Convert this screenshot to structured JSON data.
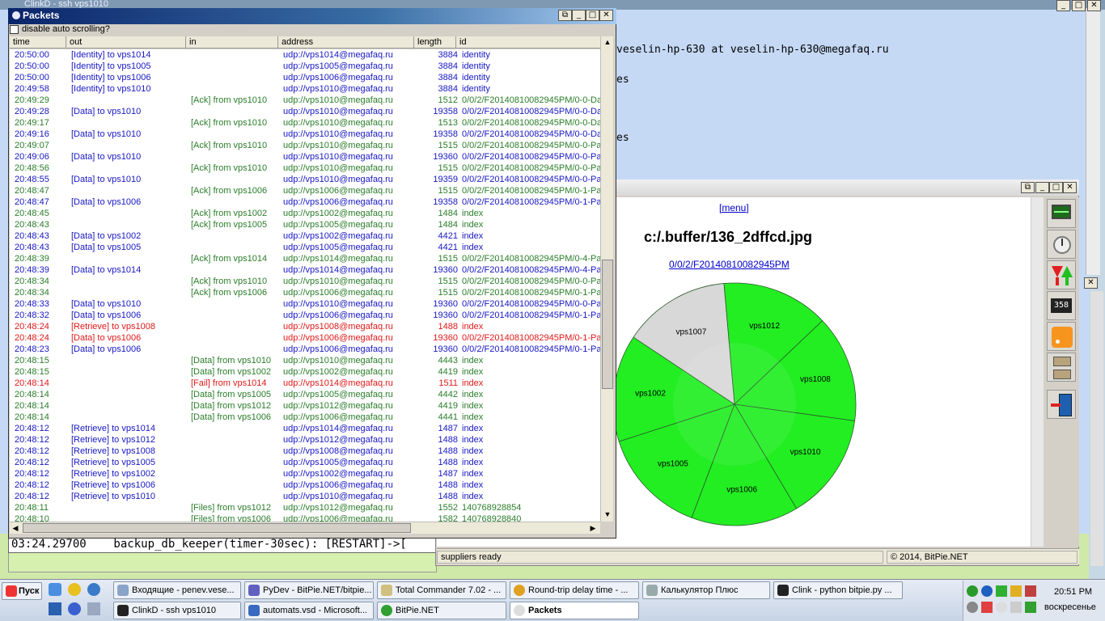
{
  "ssh_window": {
    "title": "ClinkD - ssh vps1010",
    "terminal_lines": [
      "veselin-hp-630 at veselin-hp-630@megafaq.ru",
      "es",
      "es"
    ],
    "bottom_line": "03:24.29700    backup_db_keeper(timer-30sec): [RESTART]->["
  },
  "packets_window": {
    "title": "Packets",
    "disable_autoscroll_label": "disable auto scrolling?",
    "columns": [
      "time",
      "out",
      "in",
      "address",
      "length",
      "id"
    ],
    "rows": [
      {
        "time": "20:50:00",
        "out": "[Identity] to vps1014",
        "in": "",
        "address": "udp://vps1014@megafaq.ru",
        "length": "3884",
        "id": "identity",
        "color": "blue"
      },
      {
        "time": "20:50:00",
        "out": "[Identity] to vps1005",
        "in": "",
        "address": "udp://vps1005@megafaq.ru",
        "length": "3884",
        "id": "identity",
        "color": "blue"
      },
      {
        "time": "20:50:00",
        "out": "[Identity] to vps1006",
        "in": "",
        "address": "udp://vps1006@megafaq.ru",
        "length": "3884",
        "id": "identity",
        "color": "blue"
      },
      {
        "time": "20:49:58",
        "out": "[Identity] to vps1010",
        "in": "",
        "address": "udp://vps1010@megafaq.ru",
        "length": "3884",
        "id": "identity",
        "color": "blue"
      },
      {
        "time": "20:49:29",
        "out": "",
        "in": "[Ack] from vps1010",
        "address": "udp://vps1010@megafaq.ru",
        "length": "1512",
        "id": "0/0/2/F20140810082945PM/0-0-Da",
        "color": "green"
      },
      {
        "time": "20:49:28",
        "out": "[Data] to vps1010",
        "in": "",
        "address": "udp://vps1010@megafaq.ru",
        "length": "19358",
        "id": "0/0/2/F20140810082945PM/0-0-Da",
        "color": "blue"
      },
      {
        "time": "20:49:17",
        "out": "",
        "in": "[Ack] from vps1010",
        "address": "udp://vps1010@megafaq.ru",
        "length": "1513",
        "id": "0/0/2/F20140810082945PM/0-0-Da",
        "color": "green"
      },
      {
        "time": "20:49:16",
        "out": "[Data] to vps1010",
        "in": "",
        "address": "udp://vps1010@megafaq.ru",
        "length": "19358",
        "id": "0/0/2/F20140810082945PM/0-0-Da",
        "color": "blue"
      },
      {
        "time": "20:49:07",
        "out": "",
        "in": "[Ack] from vps1010",
        "address": "udp://vps1010@megafaq.ru",
        "length": "1515",
        "id": "0/0/2/F20140810082945PM/0-0-Pa",
        "color": "green"
      },
      {
        "time": "20:49:06",
        "out": "[Data] to vps1010",
        "in": "",
        "address": "udp://vps1010@megafaq.ru",
        "length": "19360",
        "id": "0/0/2/F20140810082945PM/0-0-Pa",
        "color": "blue"
      },
      {
        "time": "20:48:56",
        "out": "",
        "in": "[Ack] from vps1010",
        "address": "udp://vps1010@megafaq.ru",
        "length": "1515",
        "id": "0/0/2/F20140810082945PM/0-0-Pa",
        "color": "green"
      },
      {
        "time": "20:48:55",
        "out": "[Data] to vps1010",
        "in": "",
        "address": "udp://vps1010@megafaq.ru",
        "length": "19359",
        "id": "0/0/2/F20140810082945PM/0-0-Pa",
        "color": "blue"
      },
      {
        "time": "20:48:47",
        "out": "",
        "in": "[Ack] from vps1006",
        "address": "udp://vps1006@megafaq.ru",
        "length": "1515",
        "id": "0/0/2/F20140810082945PM/0-1-Pa",
        "color": "green"
      },
      {
        "time": "20:48:47",
        "out": "[Data] to vps1006",
        "in": "",
        "address": "udp://vps1006@megafaq.ru",
        "length": "19358",
        "id": "0/0/2/F20140810082945PM/0-1-Pa",
        "color": "blue"
      },
      {
        "time": "20:48:45",
        "out": "",
        "in": "[Ack] from vps1002",
        "address": "udp://vps1002@megafaq.ru",
        "length": "1484",
        "id": "index",
        "color": "green"
      },
      {
        "time": "20:48:43",
        "out": "",
        "in": "[Ack] from vps1005",
        "address": "udp://vps1005@megafaq.ru",
        "length": "1484",
        "id": "index",
        "color": "green"
      },
      {
        "time": "20:48:43",
        "out": "[Data] to vps1002",
        "in": "",
        "address": "udp://vps1002@megafaq.ru",
        "length": "4421",
        "id": "index",
        "color": "blue"
      },
      {
        "time": "20:48:43",
        "out": "[Data] to vps1005",
        "in": "",
        "address": "udp://vps1005@megafaq.ru",
        "length": "4421",
        "id": "index",
        "color": "blue"
      },
      {
        "time": "20:48:39",
        "out": "",
        "in": "[Ack] from vps1014",
        "address": "udp://vps1014@megafaq.ru",
        "length": "1515",
        "id": "0/0/2/F20140810082945PM/0-4-Pa",
        "color": "green"
      },
      {
        "time": "20:48:39",
        "out": "[Data] to vps1014",
        "in": "",
        "address": "udp://vps1014@megafaq.ru",
        "length": "19360",
        "id": "0/0/2/F20140810082945PM/0-4-Pa",
        "color": "blue"
      },
      {
        "time": "20:48:34",
        "out": "",
        "in": "[Ack] from vps1010",
        "address": "udp://vps1010@megafaq.ru",
        "length": "1515",
        "id": "0/0/2/F20140810082945PM/0-0-Pa",
        "color": "green"
      },
      {
        "time": "20:48:34",
        "out": "",
        "in": "[Ack] from vps1006",
        "address": "udp://vps1006@megafaq.ru",
        "length": "1515",
        "id": "0/0/2/F20140810082945PM/0-1-Pa",
        "color": "green"
      },
      {
        "time": "20:48:33",
        "out": "[Data] to vps1010",
        "in": "",
        "address": "udp://vps1010@megafaq.ru",
        "length": "19360",
        "id": "0/0/2/F20140810082945PM/0-0-Pa",
        "color": "blue"
      },
      {
        "time": "20:48:32",
        "out": "[Data] to vps1006",
        "in": "",
        "address": "udp://vps1006@megafaq.ru",
        "length": "19360",
        "id": "0/0/2/F20140810082945PM/0-1-Pa",
        "color": "blue"
      },
      {
        "time": "20:48:24",
        "out": "[Retrieve] to vps1008",
        "in": "",
        "address": "udp://vps1008@megafaq.ru",
        "length": "1488",
        "id": "index",
        "color": "red"
      },
      {
        "time": "20:48:24",
        "out": "[Data] to vps1006",
        "in": "",
        "address": "udp://vps1006@megafaq.ru",
        "length": "19360",
        "id": "0/0/2/F20140810082945PM/0-1-Pa",
        "color": "red"
      },
      {
        "time": "20:48:23",
        "out": "[Data] to vps1006",
        "in": "",
        "address": "udp://vps1006@megafaq.ru",
        "length": "19360",
        "id": "0/0/2/F20140810082945PM/0-1-Pa",
        "color": "blue"
      },
      {
        "time": "20:48:15",
        "out": "",
        "in": "[Data] from vps1010",
        "address": "udp://vps1010@megafaq.ru",
        "length": "4443",
        "id": "index",
        "color": "green"
      },
      {
        "time": "20:48:15",
        "out": "",
        "in": "[Data] from vps1002",
        "address": "udp://vps1002@megafaq.ru",
        "length": "4419",
        "id": "index",
        "color": "green"
      },
      {
        "time": "20:48:14",
        "out": "",
        "in": "[Fail] from vps1014",
        "address": "udp://vps1014@megafaq.ru",
        "length": "1511",
        "id": "index",
        "color": "red"
      },
      {
        "time": "20:48:14",
        "out": "",
        "in": "[Data] from vps1005",
        "address": "udp://vps1005@megafaq.ru",
        "length": "4442",
        "id": "index",
        "color": "green"
      },
      {
        "time": "20:48:14",
        "out": "",
        "in": "[Data] from vps1012",
        "address": "udp://vps1012@megafaq.ru",
        "length": "4419",
        "id": "index",
        "color": "green"
      },
      {
        "time": "20:48:14",
        "out": "",
        "in": "[Data] from vps1006",
        "address": "udp://vps1006@megafaq.ru",
        "length": "4441",
        "id": "index",
        "color": "green"
      },
      {
        "time": "20:48:12",
        "out": "[Retrieve] to vps1014",
        "in": "",
        "address": "udp://vps1014@megafaq.ru",
        "length": "1487",
        "id": "index",
        "color": "blue"
      },
      {
        "time": "20:48:12",
        "out": "[Retrieve] to vps1012",
        "in": "",
        "address": "udp://vps1012@megafaq.ru",
        "length": "1488",
        "id": "index",
        "color": "blue"
      },
      {
        "time": "20:48:12",
        "out": "[Retrieve] to vps1008",
        "in": "",
        "address": "udp://vps1008@megafaq.ru",
        "length": "1488",
        "id": "index",
        "color": "blue"
      },
      {
        "time": "20:48:12",
        "out": "[Retrieve] to vps1005",
        "in": "",
        "address": "udp://vps1005@megafaq.ru",
        "length": "1488",
        "id": "index",
        "color": "blue"
      },
      {
        "time": "20:48:12",
        "out": "[Retrieve] to vps1002",
        "in": "",
        "address": "udp://vps1002@megafaq.ru",
        "length": "1487",
        "id": "index",
        "color": "blue"
      },
      {
        "time": "20:48:12",
        "out": "[Retrieve] to vps1006",
        "in": "",
        "address": "udp://vps1006@megafaq.ru",
        "length": "1488",
        "id": "index",
        "color": "blue"
      },
      {
        "time": "20:48:12",
        "out": "[Retrieve] to vps1010",
        "in": "",
        "address": "udp://vps1010@megafaq.ru",
        "length": "1488",
        "id": "index",
        "color": "blue"
      },
      {
        "time": "20:48:11",
        "out": "",
        "in": "[Files] from vps1012",
        "address": "udp://vps1012@megafaq.ru",
        "length": "1552",
        "id": "140768928854",
        "color": "green"
      },
      {
        "time": "20:48:10",
        "out": "",
        "in": "[Files] from vps1006",
        "address": "udp://vps1006@megafaq.ru",
        "length": "1582",
        "id": "140768928840",
        "color": "green"
      }
    ]
  },
  "bitpie_window": {
    "menu_link": "[menu]",
    "file_title": "c:/.buffer/136_2dffcd.jpg",
    "file_link": "0/0/2/F20140810082945PM",
    "status_left": "suppliers ready",
    "status_right": "© 2014, BitPie.NET",
    "pie_slices": [
      {
        "label": "vps1012",
        "color": "#22ee22"
      },
      {
        "label": "vps1008",
        "color": "#22ee22"
      },
      {
        "label": "vps1010",
        "color": "#22ee22"
      },
      {
        "label": "vps1006",
        "color": "#22ee22"
      },
      {
        "label": "vps1005",
        "color": "#22ee22"
      },
      {
        "label": "vps1002",
        "color": "#22ee22"
      },
      {
        "label": "vps1007",
        "color": "#d8d8d8"
      }
    ],
    "tools": [
      "monitor-icon",
      "clock-icon",
      "transfer-arrows-icon",
      "counter-icon",
      "rss-icon",
      "storage-icon",
      "exit-door-icon"
    ],
    "tool_counter_text": "358"
  },
  "taskbar": {
    "start_label": "Пуск",
    "row1": [
      "Входящие - penev.vese...",
      "PyDev - BitPie.NET/bitpie...",
      "Total Commander 7.02 - ...",
      "Round-trip delay time - ...",
      "Калькулятор Плюс",
      "Clink  - python bitpie.py ..."
    ],
    "row2": [
      "ClinkD  - ssh vps1010",
      "automats.vsd - Microsoft...",
      "BitPie.NET",
      "Packets"
    ],
    "clock": "20:51 PM",
    "day": "воскресенье"
  }
}
